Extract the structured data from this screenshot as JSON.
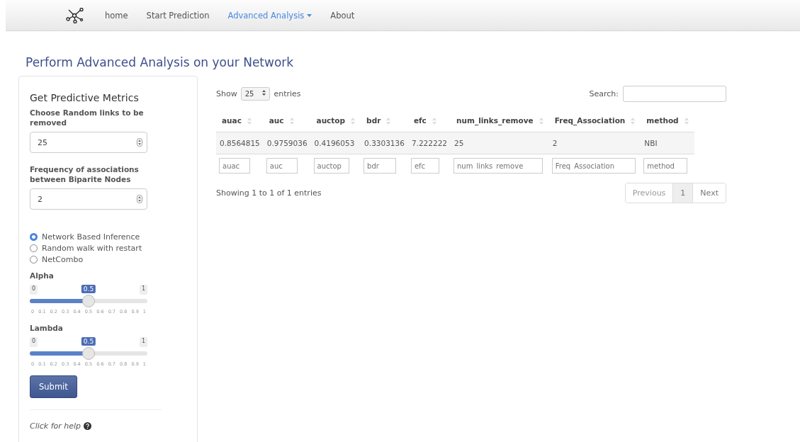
{
  "navbar": {
    "items": [
      {
        "label": "home",
        "selected": false,
        "dropdown": false
      },
      {
        "label": "Start Prediction",
        "selected": false,
        "dropdown": false
      },
      {
        "label": "Advanced Analysis",
        "selected": true,
        "dropdown": true
      },
      {
        "label": "About",
        "selected": false,
        "dropdown": false
      }
    ]
  },
  "page_title": "Perform Advanced Analysis on your Network",
  "sidebar": {
    "heading": "Get Predictive Metrics",
    "fields": [
      {
        "label": "Choose Random links to be removed",
        "value": "25"
      },
      {
        "label": "Frequency of associations between Biparite Nodes",
        "value": "2"
      }
    ],
    "radios": [
      {
        "label": "Network Based Inference",
        "selected": true
      },
      {
        "label": "Random walk with restart",
        "selected": false
      },
      {
        "label": "NetCombo",
        "selected": false
      }
    ],
    "sliders": [
      {
        "label": "Alpha",
        "min": "0",
        "max": "1",
        "value": "0.5",
        "level": 0.5,
        "ticks": [
          "0",
          "0.1",
          "0.2",
          "0.3",
          "0.4",
          "0.5",
          "0.6",
          "0.7",
          "0.8",
          "0.9",
          "1"
        ]
      },
      {
        "label": "Lambda",
        "min": "0",
        "max": "1",
        "value": "0.5",
        "level": 0.5,
        "ticks": [
          "0",
          "0.1",
          "0.2",
          "0.3",
          "0.4",
          "0.5",
          "0.6",
          "0.7",
          "0.8",
          "0.9",
          "1"
        ]
      }
    ],
    "submit": "Submit",
    "help": "Click for help"
  },
  "table": {
    "show_label": "Show",
    "page_size": "25",
    "entries_label": "entries",
    "search_label": "Search:",
    "columns": [
      "auac",
      "auc",
      "auctop",
      "bdr",
      "efc",
      "num_links_remove",
      "Freq_Association",
      "method"
    ],
    "rows": [
      [
        "0.8564815",
        "0.9759036",
        "0.4196053",
        "0.3303136",
        "7.222222",
        "25",
        "2",
        "NBI"
      ]
    ],
    "filters": [
      {
        "placeholder": "auac"
      },
      {
        "placeholder": "auc"
      },
      {
        "placeholder": "auctop"
      },
      {
        "placeholder": "bdr"
      },
      {
        "placeholder": "efc"
      },
      {
        "placeholder": "num_links_remove"
      },
      {
        "placeholder": "Freq_Association"
      },
      {
        "placeholder": "method"
      }
    ],
    "info": "Showing 1 to 1 of 1 entries",
    "pagination": [
      {
        "label": "Previous",
        "selected": false,
        "disabled": true
      },
      {
        "label": "1",
        "selected": true,
        "disabled": false
      },
      {
        "label": "Next",
        "selected": false,
        "disabled": false
      }
    ]
  }
}
